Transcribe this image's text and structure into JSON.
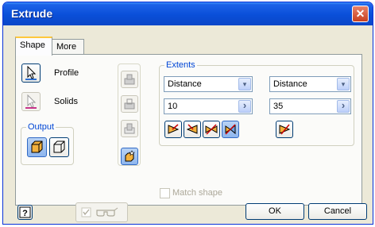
{
  "window": {
    "title": "Extrude",
    "close_glyph": "✕"
  },
  "tabs": [
    {
      "label": "Shape",
      "active": true
    },
    {
      "label": "More",
      "active": false
    }
  ],
  "inputs": {
    "profile_label": "Profile",
    "solids_label": "Solids"
  },
  "output": {
    "group_label": "Output"
  },
  "extents": {
    "group_label": "Extents",
    "select_left": "Distance",
    "select_right": "Distance",
    "value_left": "10",
    "value_right": "35",
    "arrow_glyph": "›",
    "dropdown_glyph": "▾"
  },
  "match_shape_label": "Match shape",
  "footer": {
    "help_glyph": "?",
    "ok_label": "OK",
    "cancel_label": "Cancel"
  },
  "colors": {
    "title_bar": "#0a4fd8",
    "close": "#c8401f",
    "accent_orange": "#e07b1a",
    "pressed_blue": "#8eb6ee"
  }
}
